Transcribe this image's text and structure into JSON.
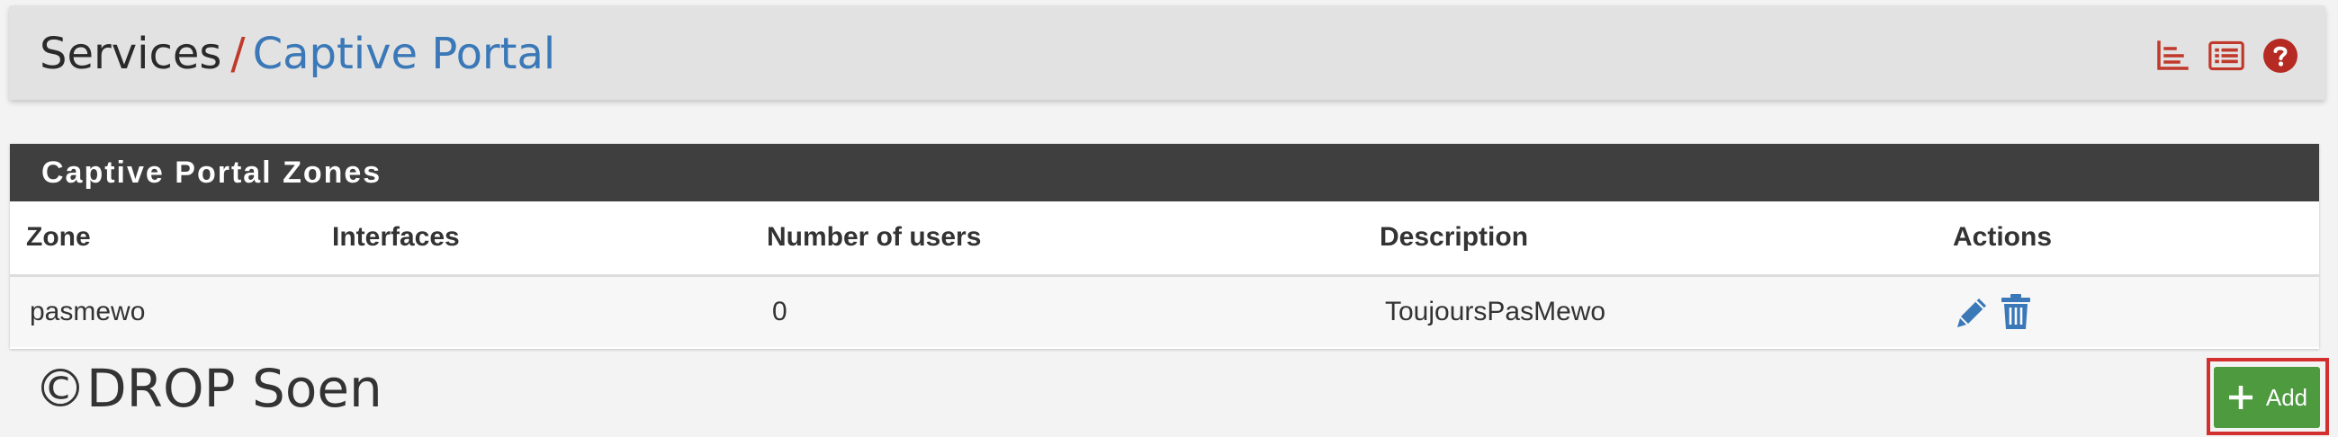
{
  "breadcrumb": {
    "parent": "Services",
    "separator": "/",
    "current": "Captive Portal"
  },
  "header_icons": [
    "bar-chart-icon",
    "list-icon",
    "help-icon"
  ],
  "panel": {
    "title": "Captive Portal Zones",
    "columns": [
      "Zone",
      "Interfaces",
      "Number of users",
      "Description",
      "Actions"
    ],
    "rows": [
      {
        "zone": "pasmewo",
        "interfaces": "",
        "users": "0",
        "description": "ToujoursPasMewo",
        "actions": [
          "edit-icon",
          "delete-icon"
        ]
      }
    ]
  },
  "watermark": "©DROP Soen",
  "add_button": {
    "label": "Add",
    "icon": "plus-icon"
  },
  "colors": {
    "accent_link": "#3a78b8",
    "separator_red": "#c0392b",
    "panel_heading": "#3f3f3f",
    "add_green": "#4d9a3f",
    "highlight_red": "#d32f2f"
  }
}
